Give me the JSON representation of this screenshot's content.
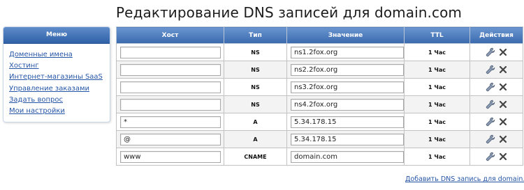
{
  "page": {
    "title": "Редактирование DNS записей для domain.com"
  },
  "sidebar": {
    "title": "Меню",
    "items": [
      {
        "label": "Доменные имена"
      },
      {
        "label": "Хостинг"
      },
      {
        "label": "Интернет-магазины SaaS"
      },
      {
        "label": "Управление заказами"
      },
      {
        "label": "Задать вопрос"
      },
      {
        "label": "Мои настройки"
      }
    ]
  },
  "table": {
    "headers": {
      "host": "Хост",
      "type": "Тип",
      "value": "Значение",
      "ttl": "TTL",
      "actions": "Действия"
    },
    "rows": [
      {
        "host": "",
        "type": "NS",
        "value": "ns1.2fox.org",
        "ttl": "1 Час"
      },
      {
        "host": "",
        "type": "NS",
        "value": "ns2.2fox.org",
        "ttl": "1 Час"
      },
      {
        "host": "",
        "type": "NS",
        "value": "ns3.2fox.org",
        "ttl": "1 Час"
      },
      {
        "host": "",
        "type": "NS",
        "value": "ns4.2fox.org",
        "ttl": "1 Час"
      },
      {
        "host": "*",
        "type": "A",
        "value": "5.34.178.15",
        "ttl": "1 Час"
      },
      {
        "host": "@",
        "type": "A",
        "value": "5.34.178.15",
        "ttl": "1 Час"
      },
      {
        "host": "www",
        "type": "CNAME",
        "value": "domain.com",
        "ttl": "1 Час"
      }
    ],
    "row_icons": {
      "edit": "wrench-icon",
      "delete": "close-x-icon"
    }
  },
  "footer": {
    "add_link": "Добавить DNS запись для domain.com"
  },
  "colors": {
    "header_blue": "#3a6aae",
    "link_blue": "#2455a6",
    "delete_gray": "#444444"
  }
}
